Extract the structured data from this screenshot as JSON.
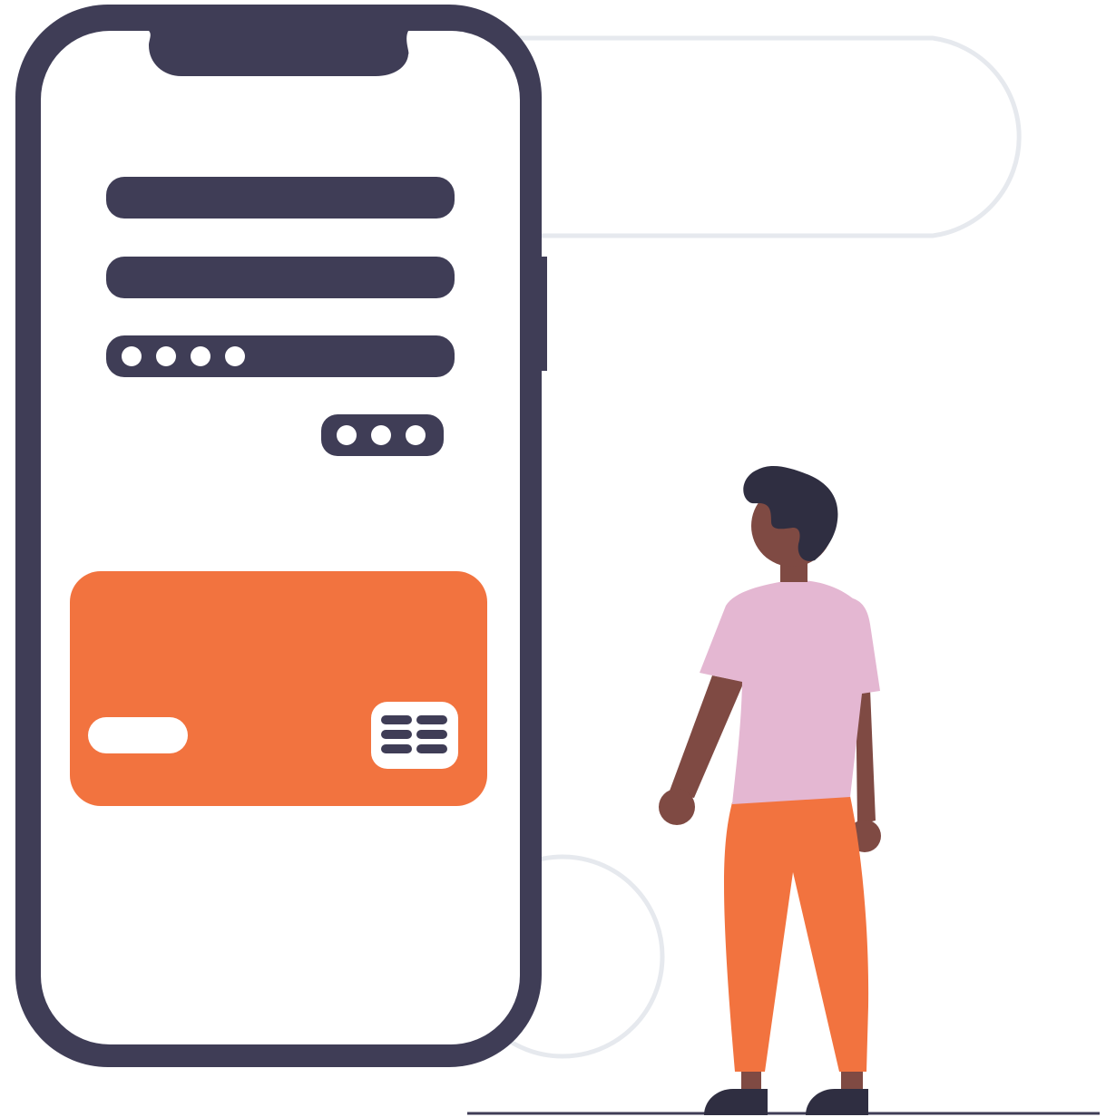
{
  "illustration": {
    "kind": "mobile-payment",
    "colors": {
      "dark": "#3f3d56",
      "accent": "#f2733f",
      "shirt": "#e4b7d2",
      "skin": "#7f4a43",
      "hair": "#2f2e41",
      "outline": "#e6e9ee",
      "white": "#ffffff"
    },
    "phone": {
      "form_fields": [
        {
          "field": "username-bar",
          "mask_dots": 0
        },
        {
          "field": "email-bar",
          "mask_dots": 0
        },
        {
          "field": "password-bar",
          "mask_dots": 4
        }
      ],
      "pin_field_dots": 3,
      "card": {
        "chip_rows": 3,
        "chip_cols": 2
      }
    },
    "person": {
      "facing": "toward-phone"
    }
  }
}
